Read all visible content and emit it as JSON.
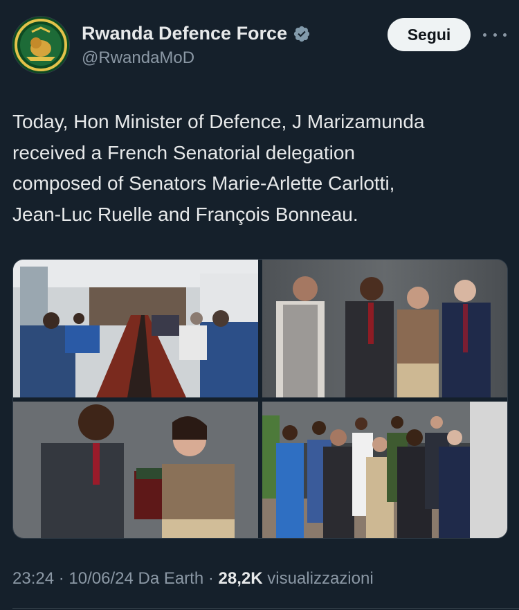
{
  "author": {
    "display_name": "Rwanda Defence Force",
    "handle": "@RwandaMoD",
    "verified": true,
    "avatar_icon": "rdf-emblem-icon"
  },
  "actions": {
    "follow_label": "Segui",
    "more_icon": "more-horizontal-icon"
  },
  "tweet": {
    "text_lines": [
      "Today, Hon Minister of Defence, J Marizamunda",
      "received a French Senatorial delegation",
      "composed of Senators Marie-Arlette Carlotti,",
      "Jean-Luc Ruelle and François Bonneau."
    ]
  },
  "media": {
    "count": 4,
    "photos": [
      {
        "subject": "meeting-room-photo"
      },
      {
        "subject": "delegation-group-photo"
      },
      {
        "subject": "gift-exchange-photo"
      },
      {
        "subject": "outdoor-group-photo"
      }
    ]
  },
  "meta": {
    "time": "23:24",
    "sep1": " · ",
    "date": "10/06/24",
    "source": " Da Earth",
    "sep2": " · ",
    "views_count": "28,2K",
    "views_label": " visualizzazioni"
  },
  "colors": {
    "background": "#15202b",
    "text": "#e7e9ea",
    "secondary": "#8b98a5",
    "verified_badge": "#829aab",
    "follow_bg": "#eff3f4"
  }
}
